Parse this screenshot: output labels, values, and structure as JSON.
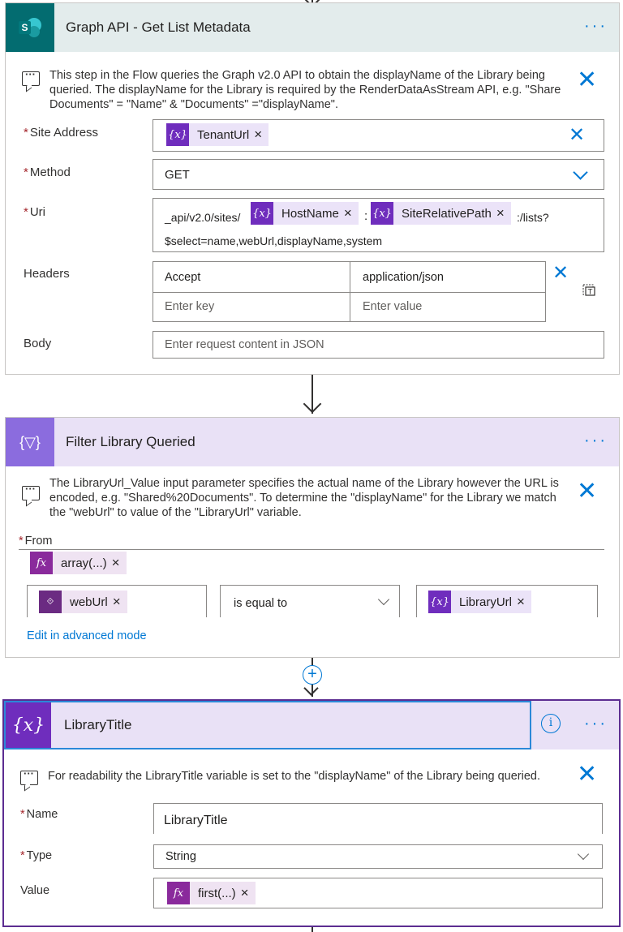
{
  "card1": {
    "title": "Graph API - Get List Metadata",
    "comment": "This step in the Flow queries the Graph v2.0 API to obtain the displayName of the Library being queried. The displayName for the Library is required by the RenderDataAsStream API, e.g. \"Share Documents\" = \"Name\" & \"Documents\" =\"displayName\".",
    "site_address_label": "Site Address",
    "site_address_token": "TenantUrl",
    "method_label": "Method",
    "method_value": "GET",
    "uri_label": "Uri",
    "uri_prefix": "_api/v2.0/sites/",
    "uri_token1": "HostName",
    "uri_colon": ":",
    "uri_token2": "SiteRelativePath",
    "uri_suffix": ":/lists?",
    "uri_line2": "$select=name,webUrl,displayName,system",
    "headers_label": "Headers",
    "header_key": "Accept",
    "header_value": "application/json",
    "header_key_placeholder": "Enter key",
    "header_value_placeholder": "Enter value",
    "body_label": "Body",
    "body_placeholder": "Enter request content in JSON"
  },
  "card2": {
    "title": "Filter Library Queried",
    "comment": "The LibraryUrl_Value input parameter specifies the actual name of the Library however the URL is encoded, e.g. \"Shared%20Documents\". To determine the \"displayName\" for the Library we match the \"webUrl\" to value of the \"LibraryUrl\" variable.",
    "from_label": "From",
    "from_token": "array(...)",
    "left_token": "webUrl",
    "operator": "is equal to",
    "right_token": "LibraryUrl",
    "advanced_link": "Edit in advanced mode"
  },
  "card3": {
    "title": "LibraryTitle",
    "comment": "For readability the LibraryTitle variable is set to the \"displayName\" of the Library being queried.",
    "name_label": "Name",
    "name_value": "LibraryTitle",
    "type_label": "Type",
    "type_value": "String",
    "value_label": "Value",
    "value_token": "first(...)"
  },
  "icons": {
    "var": "{x}",
    "fx": "fx",
    "dots": "···",
    "close": "✕",
    "info": "i",
    "plus": "+",
    "filter": "{▽}",
    "sharepoint": "S"
  },
  "colors": {
    "accent": "#0078d4",
    "sharepoint_header": "#e3ecec",
    "sharepoint_icon": "#036c70",
    "variable_purple": "#6f2dbd",
    "header_lilac": "#e9e1f6",
    "selected_border": "#5c2d91",
    "token_bg": "#ebe3f8",
    "expression": "#8a2a9c"
  }
}
